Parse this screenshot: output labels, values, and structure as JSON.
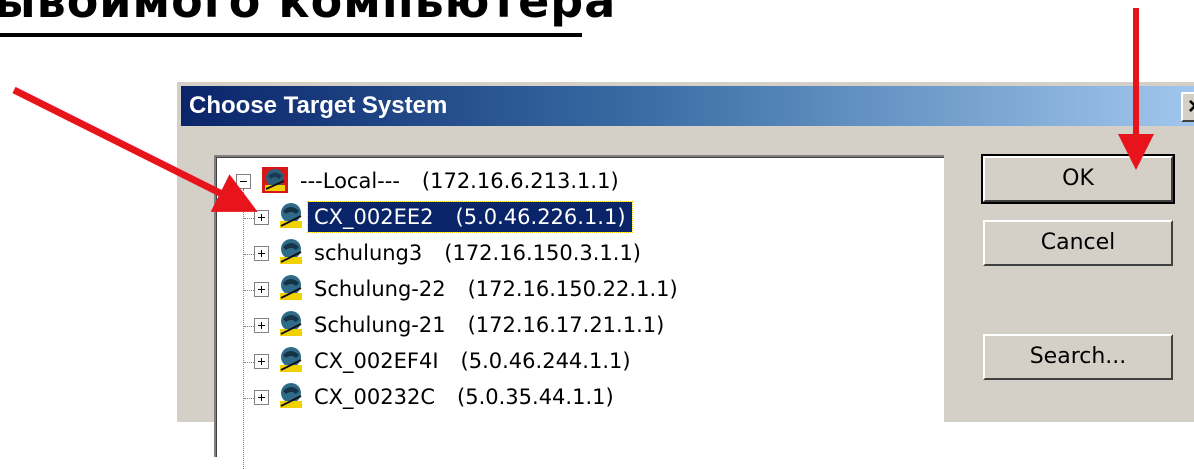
{
  "heading": {
    "text": "ывоимого компьютера"
  },
  "dialog": {
    "title": "Choose Target System",
    "close_glyph": "×",
    "buttons": {
      "ok": "OK",
      "cancel": "Cancel",
      "search": "Search..."
    },
    "tree": [
      {
        "label": "---Local---",
        "ip": "(172.16.6.213.1.1)",
        "expanded": true,
        "selected": false,
        "icon": "local-computer-icon"
      },
      {
        "label": "CX_002EE2",
        "ip": "(5.0.46.226.1.1)",
        "expanded": false,
        "selected": true,
        "icon": "network-computer-icon"
      },
      {
        "label": "schulung3",
        "ip": "(172.16.150.3.1.1)",
        "expanded": false,
        "selected": false,
        "icon": "network-computer-icon"
      },
      {
        "label": "Schulung-22",
        "ip": "(172.16.150.22.1.1)",
        "expanded": false,
        "selected": false,
        "icon": "network-computer-icon"
      },
      {
        "label": "Schulung-21",
        "ip": "(172.16.17.21.1.1)",
        "expanded": false,
        "selected": false,
        "icon": "network-computer-icon"
      },
      {
        "label": "CX_002EF4I",
        "ip": "(5.0.46.244.1.1)",
        "expanded": false,
        "selected": false,
        "icon": "network-computer-icon"
      },
      {
        "label": "CX_00232C",
        "ip": "(5.0.35.44.1.1)",
        "expanded": false,
        "selected": false,
        "icon": "network-computer-icon"
      }
    ]
  },
  "colors": {
    "titlebar_start": "#0a246a",
    "titlebar_end": "#a6caf0",
    "selection": "#0a246a",
    "arrow": "#e8141b",
    "dialog_face": "#d4d0c8"
  }
}
